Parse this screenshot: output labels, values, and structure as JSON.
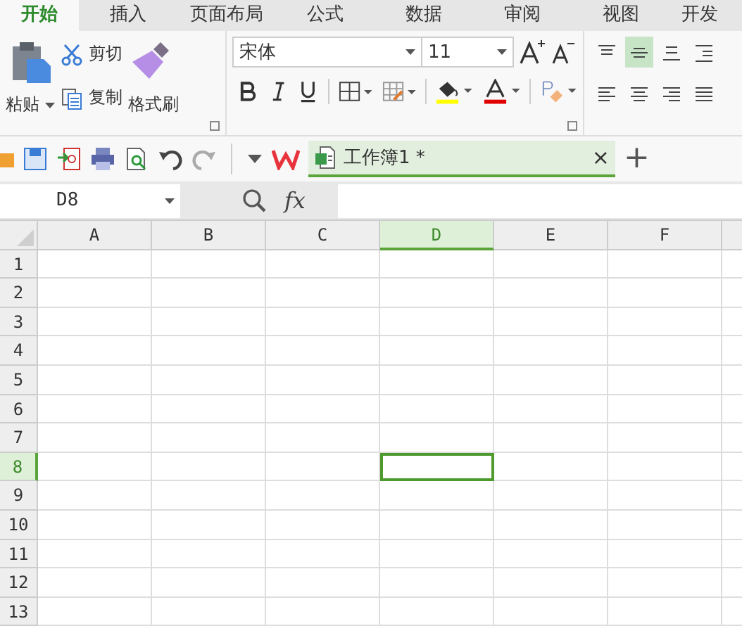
{
  "menu_tabs": [
    {
      "label": "开始",
      "selected": true
    },
    {
      "label": "插入",
      "selected": false
    },
    {
      "label": "页面布局",
      "selected": false
    },
    {
      "label": "公式",
      "selected": false
    },
    {
      "label": "数据",
      "selected": false
    },
    {
      "label": "审阅",
      "selected": false
    },
    {
      "label": "视图",
      "selected": false
    },
    {
      "label": "开发",
      "selected": false
    }
  ],
  "clipboard": {
    "paste": "粘贴",
    "cut": "剪切",
    "copy": "复制",
    "format_painter": "格式刷"
  },
  "font": {
    "name": "宋体",
    "size": "11"
  },
  "align_top_row": [
    {
      "kind": "top",
      "selected": false
    },
    {
      "kind": "middle",
      "selected": true
    },
    {
      "kind": "bottom",
      "selected": false
    },
    {
      "kind": "indent",
      "selected": false
    }
  ],
  "align_bottom_row": [
    {
      "kind": "left",
      "selected": false
    },
    {
      "kind": "center",
      "selected": false
    },
    {
      "kind": "right",
      "selected": false
    },
    {
      "kind": "justify",
      "selected": false
    }
  ],
  "document_tab": {
    "title": "工作簿1 *",
    "close": "×",
    "add": "+"
  },
  "formula_bar": {
    "name_box": "D8",
    "fx": "fx"
  },
  "columns": [
    {
      "label": "A",
      "selected": false
    },
    {
      "label": "B",
      "selected": false
    },
    {
      "label": "C",
      "selected": false
    },
    {
      "label": "D",
      "selected": true
    },
    {
      "label": "E",
      "selected": false
    },
    {
      "label": "F",
      "selected": false
    }
  ],
  "rows": [
    {
      "label": "1",
      "selected": false
    },
    {
      "label": "2",
      "selected": false
    },
    {
      "label": "3",
      "selected": false
    },
    {
      "label": "4",
      "selected": false
    },
    {
      "label": "5",
      "selected": false
    },
    {
      "label": "6",
      "selected": false
    },
    {
      "label": "7",
      "selected": false
    },
    {
      "label": "8",
      "selected": true
    },
    {
      "label": "9",
      "selected": false
    },
    {
      "label": "10",
      "selected": false
    },
    {
      "label": "11",
      "selected": false
    },
    {
      "label": "12",
      "selected": false
    },
    {
      "label": "13",
      "selected": false
    }
  ]
}
